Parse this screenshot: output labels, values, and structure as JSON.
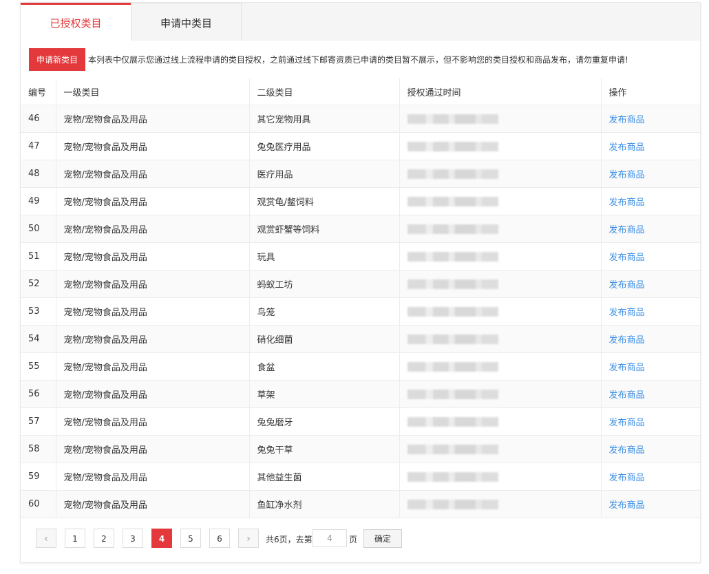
{
  "tabs": [
    {
      "label": "已授权类目",
      "active": true
    },
    {
      "label": "申请中类目",
      "active": false
    }
  ],
  "notice": {
    "button_label": "申请新类目",
    "text": "本列表中仅展示您通过线上流程申请的类目授权，之前通过线下邮寄资质已申请的类目暂不展示，但不影响您的类目授权和商品发布，请勿重复申请!"
  },
  "table": {
    "headers": [
      "编号",
      "一级类目",
      "二级类目",
      "授权通过时间",
      "操作"
    ],
    "rows": [
      {
        "id": "46",
        "level1": "宠物/宠物食品及用品",
        "level2": "其它宠物用具",
        "action": "发布商品"
      },
      {
        "id": "47",
        "level1": "宠物/宠物食品及用品",
        "level2": "兔兔医疗用品",
        "action": "发布商品"
      },
      {
        "id": "48",
        "level1": "宠物/宠物食品及用品",
        "level2": "医疗用品",
        "action": "发布商品"
      },
      {
        "id": "49",
        "level1": "宠物/宠物食品及用品",
        "level2": "观赏龟/鳖饲料",
        "action": "发布商品"
      },
      {
        "id": "50",
        "level1": "宠物/宠物食品及用品",
        "level2": "观赏虾蟹等饲料",
        "action": "发布商品"
      },
      {
        "id": "51",
        "level1": "宠物/宠物食品及用品",
        "level2": "玩具",
        "action": "发布商品"
      },
      {
        "id": "52",
        "level1": "宠物/宠物食品及用品",
        "level2": "蚂蚁工坊",
        "action": "发布商品"
      },
      {
        "id": "53",
        "level1": "宠物/宠物食品及用品",
        "level2": "鸟笼",
        "action": "发布商品"
      },
      {
        "id": "54",
        "level1": "宠物/宠物食品及用品",
        "level2": "硝化细菌",
        "action": "发布商品"
      },
      {
        "id": "55",
        "level1": "宠物/宠物食品及用品",
        "level2": "食盆",
        "action": "发布商品"
      },
      {
        "id": "56",
        "level1": "宠物/宠物食品及用品",
        "level2": "草架",
        "action": "发布商品"
      },
      {
        "id": "57",
        "level1": "宠物/宠物食品及用品",
        "level2": "兔兔磨牙",
        "action": "发布商品"
      },
      {
        "id": "58",
        "level1": "宠物/宠物食品及用品",
        "level2": "兔兔干草",
        "action": "发布商品"
      },
      {
        "id": "59",
        "level1": "宠物/宠物食品及用品",
        "level2": "其他益生菌",
        "action": "发布商品"
      },
      {
        "id": "60",
        "level1": "宠物/宠物食品及用品",
        "level2": "鱼缸净水剂",
        "action": "发布商品"
      }
    ]
  },
  "pagination": {
    "prev_icon": "‹",
    "next_icon": "›",
    "pages": [
      "1",
      "2",
      "3",
      "4",
      "5",
      "6"
    ],
    "current": "4",
    "total_text": "共6页，去第",
    "goto_value": "4",
    "page_suffix": "页",
    "confirm_label": "确定"
  },
  "colors": {
    "accent": "#e4393c",
    "link": "#3a8ee6"
  }
}
